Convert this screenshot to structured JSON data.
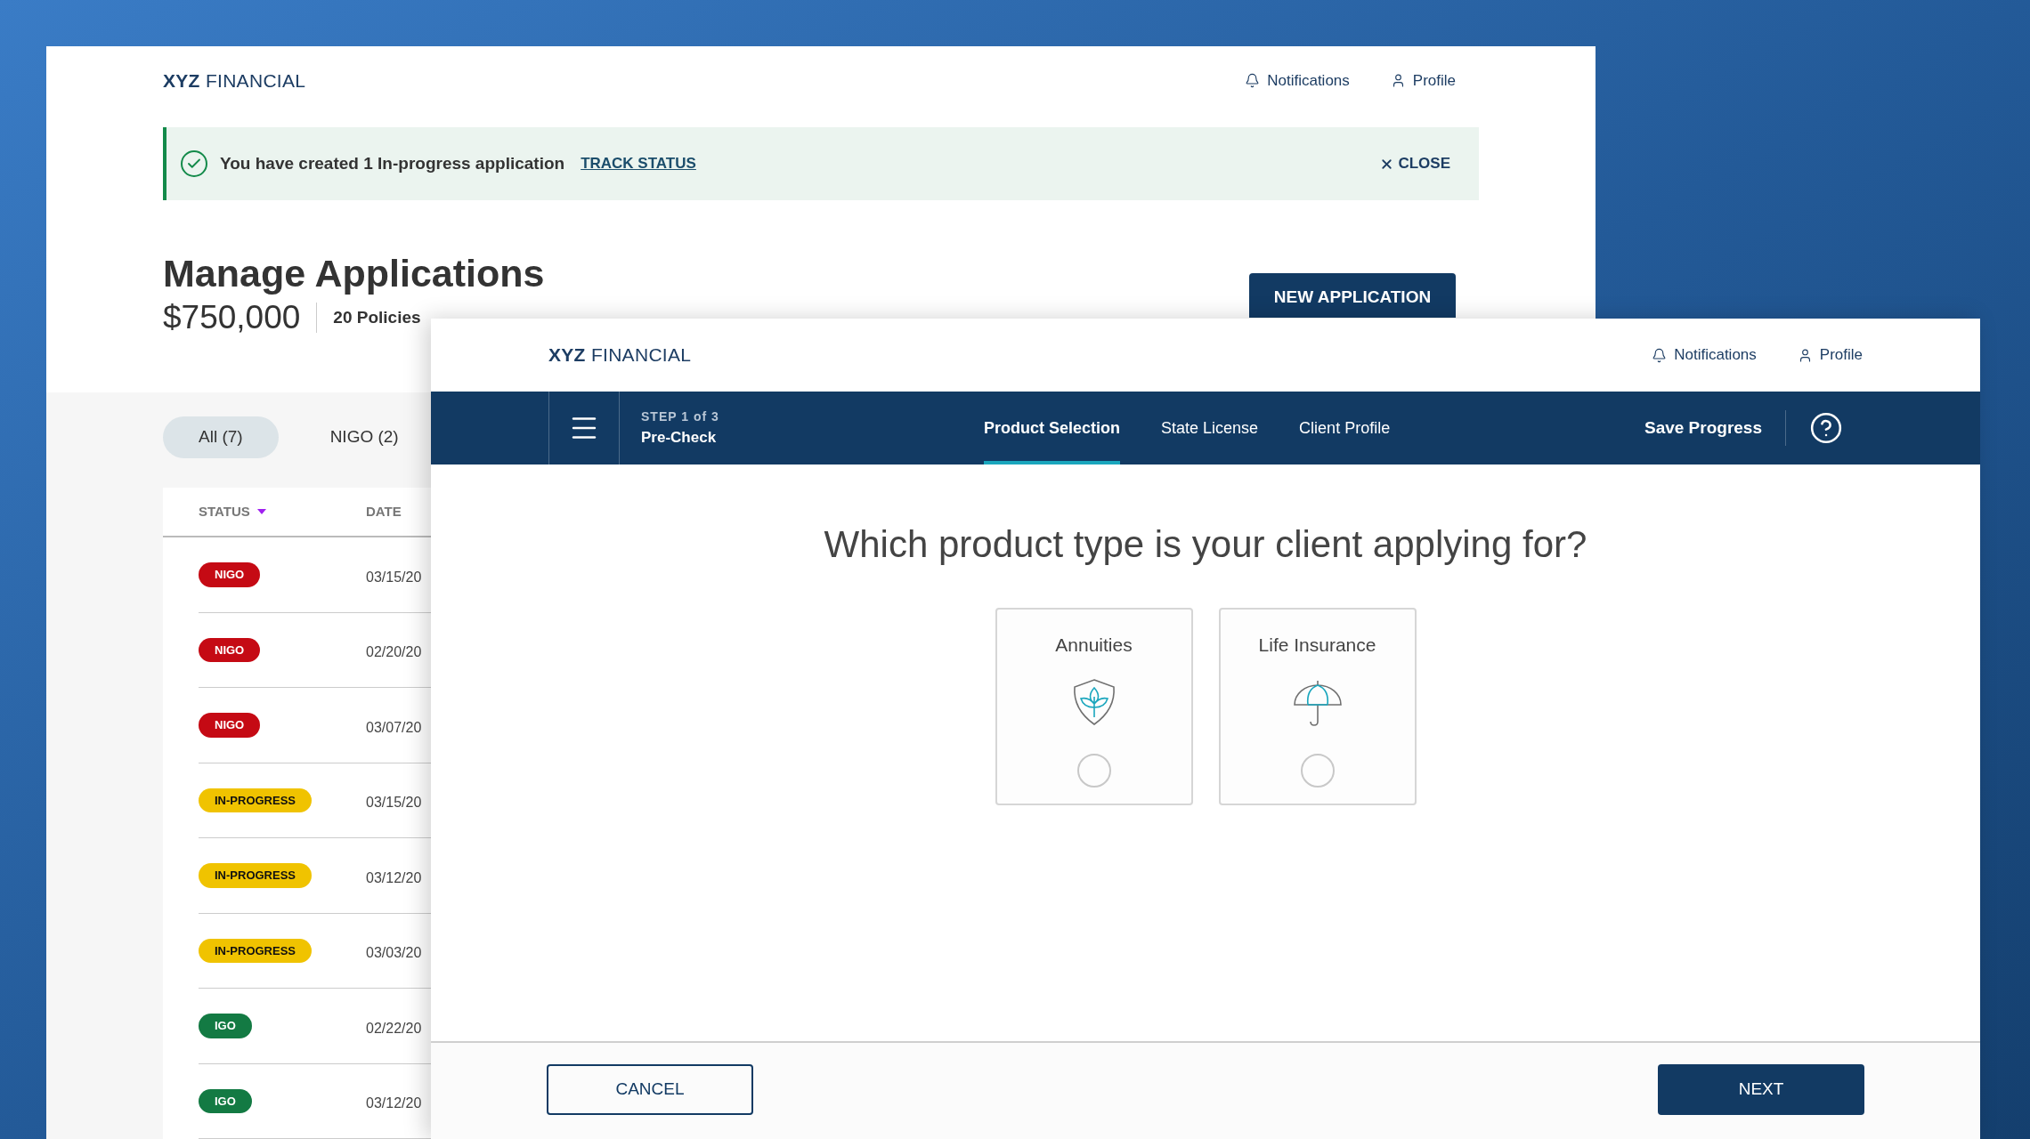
{
  "back_window": {
    "logo": "**XYZ** FINANCIAL",
    "header_links": [
      {
        "kind": "notifications",
        "label": "Notifications"
      },
      {
        "kind": "profile",
        "label": "Profile"
      }
    ],
    "banner": {
      "message": "You have created 1 In-progress application",
      "link": "TRACK STATUS",
      "close": "CLOSE"
    },
    "title": "Manage Applications",
    "amount": "$750,000",
    "policies": "20 Policies",
    "new_button": "NEW APPLICATION",
    "filter_tabs": [
      {
        "label": "All (7)",
        "selected": true
      },
      {
        "label": "NIGO (2)",
        "selected": false
      }
    ],
    "table": {
      "columns": [
        {
          "label": "STATUS",
          "sorted": true
        },
        {
          "label": "DATE",
          "sorted": false
        }
      ],
      "rows": [
        {
          "status": "NIGO",
          "kind": "nigo",
          "date": "03/15/20"
        },
        {
          "status": "NIGO",
          "kind": "nigo",
          "date": "02/20/20"
        },
        {
          "status": "NIGO",
          "kind": "nigo",
          "date": "03/07/20"
        },
        {
          "status": "IN-PROGRESS",
          "kind": "in_progress",
          "date": "03/15/20"
        },
        {
          "status": "IN-PROGRESS",
          "kind": "in_progress",
          "date": "03/12/20"
        },
        {
          "status": "IN-PROGRESS",
          "kind": "in_progress",
          "date": "03/03/20"
        },
        {
          "status": "IGO",
          "kind": "igo",
          "date": "02/22/20"
        },
        {
          "status": "IGO",
          "kind": "igo",
          "date": "03/12/20"
        }
      ]
    }
  },
  "front_window": {
    "logo": "**XYZ** FINANCIAL",
    "header_links": [
      {
        "kind": "notifications",
        "label": "Notifications"
      },
      {
        "kind": "profile",
        "label": "Profile"
      }
    ],
    "step": {
      "counter": "STEP 1 of 3",
      "name": "Pre-Check"
    },
    "tabs": [
      {
        "label": "Product Selection",
        "selected": true
      },
      {
        "label": "State License",
        "selected": false
      },
      {
        "label": "Client Profile",
        "selected": false
      }
    ],
    "save_progress": "Save Progress",
    "question": "Which product type is your client applying for?",
    "options": [
      {
        "label": "Annuities",
        "kind": "shield",
        "selected": false
      },
      {
        "label": "Life Insurance",
        "kind": "umbrella",
        "selected": false
      }
    ],
    "cancel": "CANCEL",
    "next": "NEXT"
  }
}
